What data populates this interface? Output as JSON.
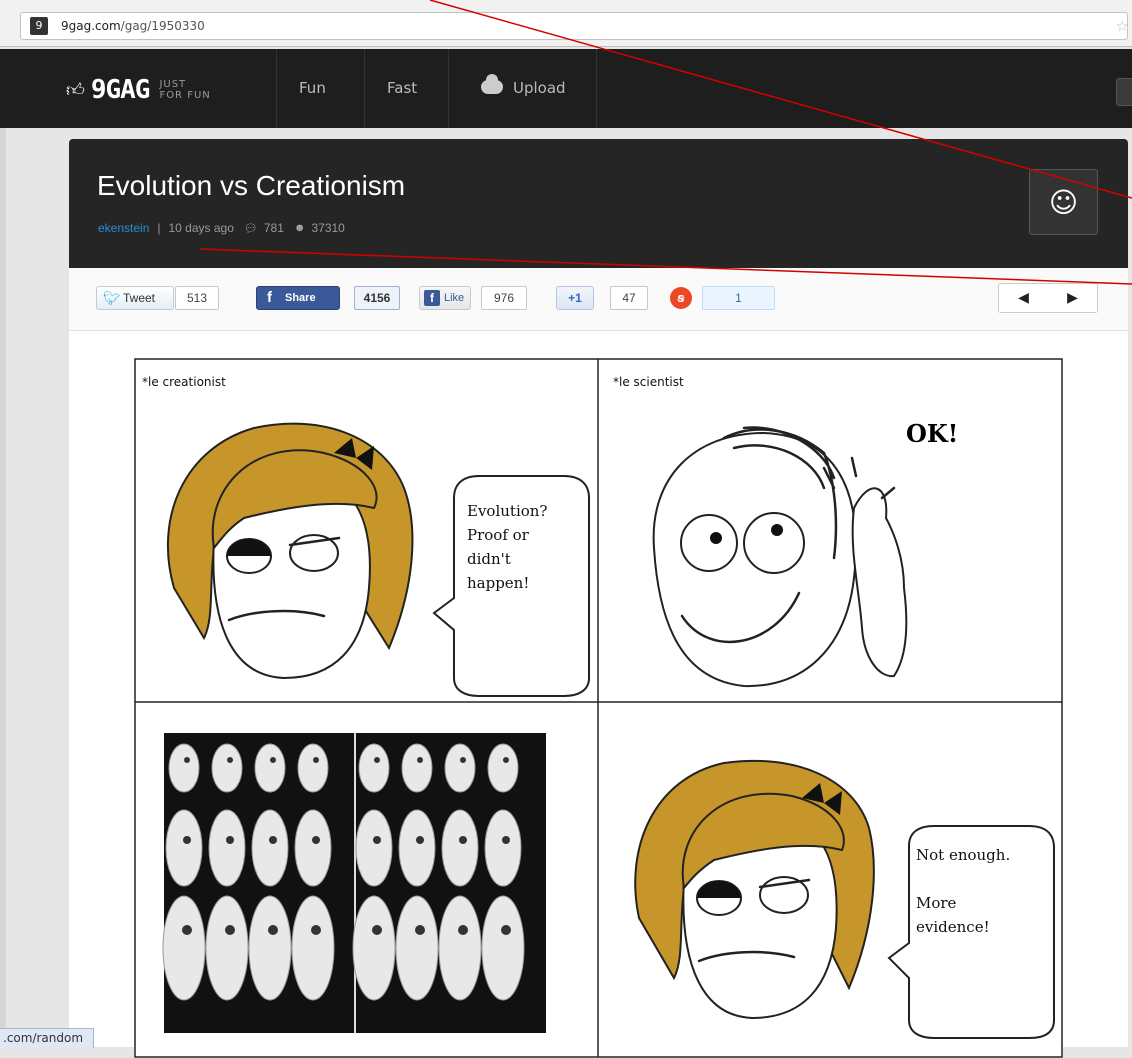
{
  "browser": {
    "url_host": "9gag.com",
    "url_path": "/gag/1950330",
    "favicon_label": "9",
    "star_icon": "star-icon",
    "status_text": ".com/random"
  },
  "site": {
    "logo_text": "9GAG",
    "logo_tag_line1": "JUST",
    "logo_tag_line2": "FOR FUN",
    "nav": {
      "fun": "Fun",
      "fast": "Fast",
      "upload": "Upload"
    }
  },
  "post": {
    "title": "Evolution vs Creationism",
    "author": "ekenstein",
    "separator": "|",
    "time_ago": "10 days ago",
    "comments": "781",
    "points": "37310",
    "reaction_icon": "☺"
  },
  "share": {
    "tweet_label": "Tweet",
    "tweet_count": "513",
    "share_label": "Share",
    "share_count": "4156",
    "like_label": "Like",
    "like_count": "976",
    "plusone_label": "+1",
    "plusone_count": "47",
    "stumble_count": "1",
    "prev_icon": "◀",
    "next_icon": "▶"
  },
  "comic": {
    "panel1_caption": "*le creationist",
    "panel2_caption": "*le scientist",
    "panel1_speech": [
      "Evolution?",
      "Proof or",
      "didn't",
      "happen!"
    ],
    "panel2_exclaim": "OK!",
    "panel4_speech": [
      "Not enough.",
      "",
      "More",
      "evidence!"
    ]
  },
  "colors": {
    "topbar": "#1e1e1e",
    "author_link": "#2a8cd6",
    "hair": "#c7962a",
    "annotation": "#d40000"
  }
}
